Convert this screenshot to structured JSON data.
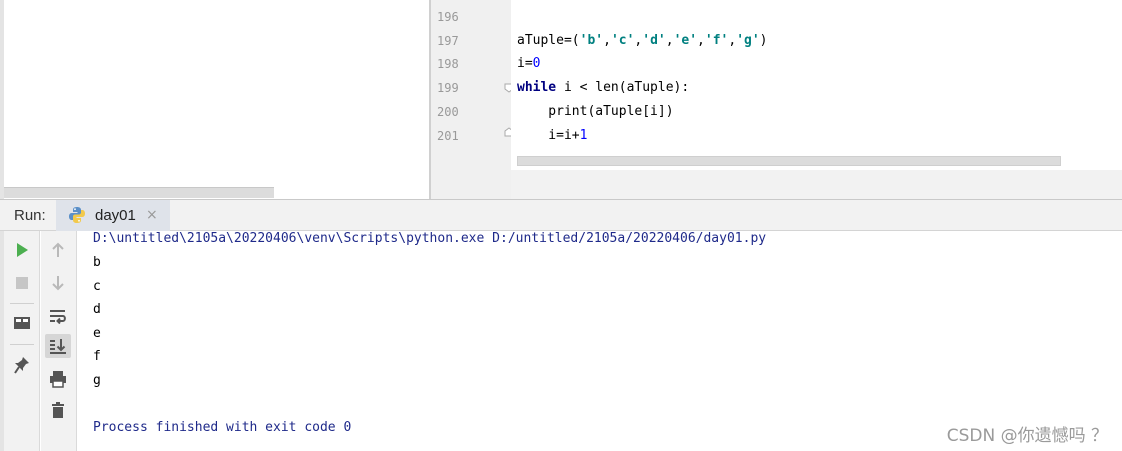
{
  "editor": {
    "lines": [
      {
        "number": "196",
        "text": ""
      },
      {
        "number": "197",
        "text": "aTuple=('b','c','d','e','f','g')"
      },
      {
        "number": "198",
        "text": "i=0"
      },
      {
        "number": "199",
        "text": "while i < len(aTuple):"
      },
      {
        "number": "200",
        "text": "    print(aTuple[i])"
      },
      {
        "number": "201",
        "text": "    i=i+1"
      }
    ]
  },
  "run": {
    "label": "Run:",
    "tab": {
      "label": "day01",
      "close": "×",
      "icon": "python-icon"
    },
    "toolbar_left": [
      "rerun-icon",
      "stop-icon",
      "layout-icon",
      "pin-icon"
    ],
    "toolbar_right": [
      "up-icon",
      "down-icon",
      "soft-wrap-icon",
      "scroll-to-end-icon",
      "print-icon",
      "delete-icon"
    ]
  },
  "console": {
    "command": "D:\\untitled\\2105a\\20220406\\venv\\Scripts\\python.exe D:/untitled/2105a/20220406/day01.py",
    "output": [
      "b",
      "c",
      "d",
      "e",
      "f",
      "g"
    ],
    "finish": "Process finished with exit code 0"
  },
  "watermark": "CSDN @你遗憾吗  ？",
  "colors": {
    "keyword": "#000080",
    "string": "#008080",
    "number": "#0000ff",
    "console_system": "#1f2a8a"
  }
}
